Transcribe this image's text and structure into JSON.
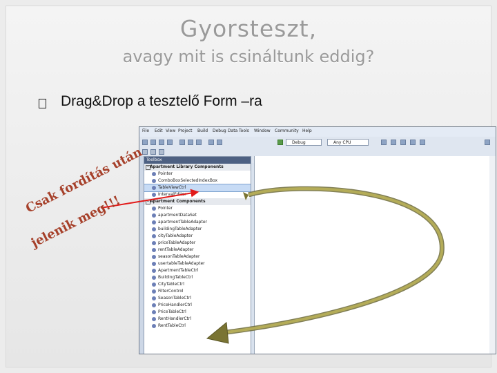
{
  "slide": {
    "title": "Gyorsteszt,",
    "subtitle": "avagy mit is csináltunk eddig?",
    "bullet_text": "Drag&Drop a tesztelő Form –ra",
    "annotation_line1": "Csak fordítás után",
    "annotation_line2": "jelenik meg!!!"
  },
  "ide": {
    "menu": [
      "File",
      "Edit",
      "View",
      "Project",
      "Build",
      "Debug",
      "Data",
      "Tools",
      "Window",
      "Community",
      "Help"
    ],
    "config_combo": "Debug",
    "platform_combo": "Any CPU",
    "toolbox_title": "Toolbox",
    "group1": "Apartment Library Components",
    "group1_items": [
      "Pointer",
      "ComboBoxSelectedIndexBox",
      "TableViewCtrl",
      "IntervalEditor"
    ],
    "group2": "Apartment Components",
    "group2_items": [
      "Pointer",
      "apartmentDataSet",
      "apartmentTableAdapter",
      "buildingTableAdapter",
      "cityTableAdapter",
      "priceTableAdapter",
      "rentTableAdapter",
      "seasonTableAdapter",
      "usertableTableAdapter",
      "ApartmentTableCtrl",
      "BuildingTableCtrl",
      "CityTableCtrl",
      "FilterControl",
      "SeasonTableCtrl",
      "PriceHandlerCtrl",
      "PriceTableCtrl",
      "RentHandlerCtrl",
      "RentTableCtrl"
    ]
  },
  "colors": {
    "annotation": "#a6402a",
    "red_arrow": "#e21a1a",
    "olive_arrow": "#7a7433"
  }
}
